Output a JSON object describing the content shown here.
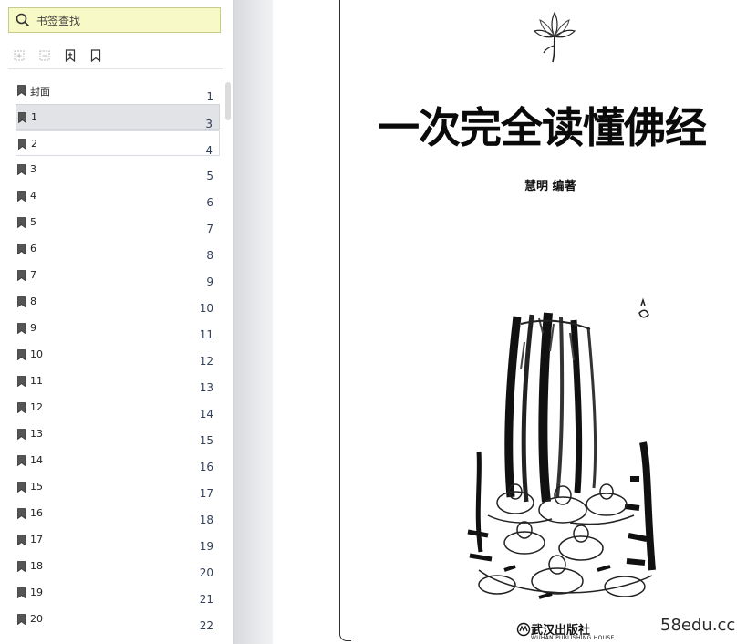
{
  "sidebar": {
    "search_placeholder": "书签查找",
    "toolbar": [
      {
        "icon": "expand-all-icon"
      },
      {
        "icon": "collapse-all-icon"
      },
      {
        "icon": "add-bookmark-icon"
      },
      {
        "icon": "bookmark-outline-icon"
      }
    ],
    "bookmarks": [
      {
        "label": "封面",
        "page": "1"
      },
      {
        "label": "1",
        "page": "3",
        "state": "selected"
      },
      {
        "label": "2",
        "page": "4",
        "state": "hover"
      },
      {
        "label": "3",
        "page": "5"
      },
      {
        "label": "4",
        "page": "6"
      },
      {
        "label": "5",
        "page": "7"
      },
      {
        "label": "6",
        "page": "8"
      },
      {
        "label": "7",
        "page": "9"
      },
      {
        "label": "8",
        "page": "10"
      },
      {
        "label": "9",
        "page": "11"
      },
      {
        "label": "10",
        "page": "12"
      },
      {
        "label": "11",
        "page": "13"
      },
      {
        "label": "12",
        "page": "14"
      },
      {
        "label": "13",
        "page": "15"
      },
      {
        "label": "14",
        "page": "16"
      },
      {
        "label": "15",
        "page": "17"
      },
      {
        "label": "16",
        "page": "18"
      },
      {
        "label": "17",
        "page": "19"
      },
      {
        "label": "18",
        "page": "20"
      },
      {
        "label": "19",
        "page": "21"
      },
      {
        "label": "20",
        "page": "22"
      }
    ]
  },
  "document": {
    "title": "一次完全读懂佛经",
    "author": "慧明  编著",
    "publisher": "武汉出版社",
    "publisher_en": "WUHAN PUBLISHING HOUSE",
    "watermark": "58edu.cc"
  },
  "colors": {
    "search_bg": "#f7f9c6",
    "selected_row": "#e2e3e6",
    "page_number": "#33405a",
    "workspace": "#eef0f2"
  }
}
